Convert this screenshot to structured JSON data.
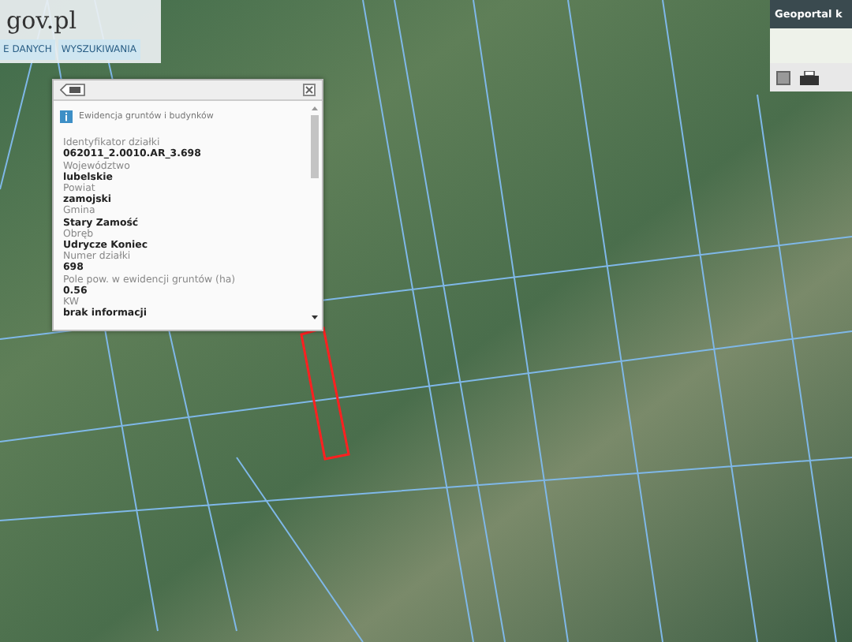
{
  "header": {
    "logo": "gov.pl",
    "tabs": [
      {
        "label": "E DANYCH"
      },
      {
        "label": "WYSZUKIWANIA"
      }
    ]
  },
  "overview": {
    "title": "Geoportal k"
  },
  "popup": {
    "title": "Ewidencja gruntów i budynków",
    "fields": [
      {
        "label": "Identyfikator działki",
        "value": "062011_2.0010.AR_3.698"
      },
      {
        "label": "Województwo",
        "value": "lubelskie"
      },
      {
        "label": "Powiat",
        "value": "zamojski"
      },
      {
        "label": "Gmina",
        "value": "Stary Zamość"
      },
      {
        "label": "Obręb",
        "value": "Udrycze Koniec"
      },
      {
        "label": "Numer działki",
        "value": "698"
      },
      {
        "label": "Pole pow. w ewidencji gruntów (ha)",
        "value": "0.56"
      },
      {
        "label": "KW",
        "value": "brak informacji"
      }
    ]
  }
}
